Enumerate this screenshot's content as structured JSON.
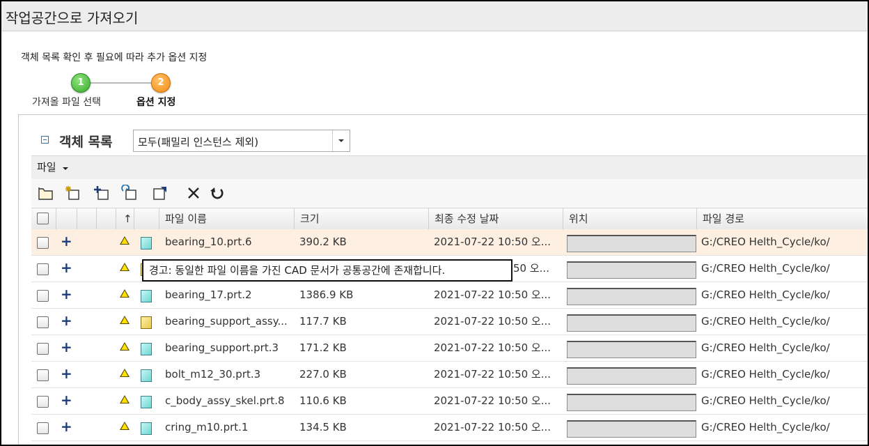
{
  "window": {
    "title": "작업공간으로 가져오기"
  },
  "instructions": "객체 목록 확인 후 필요에 따라 추가 옵션 지정",
  "steps": [
    {
      "number": "1",
      "label": "가져올 파일 선택",
      "status": "complete",
      "color": "#3fb030"
    },
    {
      "number": "2",
      "label": "옵션 지정",
      "status": "current",
      "color": "#f39a1e"
    }
  ],
  "object_list": {
    "title": "객체 목록",
    "filter_value": "모두(패밀리 인스턴스 제외)"
  },
  "menu": {
    "file_label": "파일"
  },
  "toolbar": {
    "icons": [
      "open-folder-icon",
      "new-item-icon",
      "add-item-icon",
      "refresh-item-icon",
      "export-item-icon",
      "delete-icon",
      "undo-icon"
    ]
  },
  "table": {
    "columns": {
      "sort": "↑",
      "name": "파일 이름",
      "size": "크기",
      "modified": "최종 수정 날짜",
      "location": "위치",
      "path": "파일 경로"
    },
    "rows": [
      {
        "name": "bearing_10.prt.6",
        "size": "390.2 KB",
        "modified": "2021-07-22 10:50 오...",
        "path": "G:/CREO Helth_Cycle/ko/",
        "type": "part",
        "selected": true
      },
      {
        "name": "",
        "size": "",
        "modified": "50 오...",
        "path": "G:/CREO Helth_Cycle/ko/",
        "type": "assembly",
        "selected": false
      },
      {
        "name": "bearing_17.prt.2",
        "size": "1386.9 KB",
        "modified": "2021-07-22 10:50 오...",
        "path": "G:/CREO Helth_Cycle/ko/",
        "type": "part",
        "selected": false
      },
      {
        "name": "bearing_support_assy...",
        "size": "117.7 KB",
        "modified": "2021-07-22 10:50 오...",
        "path": "G:/CREO Helth_Cycle/ko/",
        "type": "assembly",
        "selected": false
      },
      {
        "name": "bearing_support.prt.3",
        "size": "171.2 KB",
        "modified": "2021-07-22 10:50 오...",
        "path": "G:/CREO Helth_Cycle/ko/",
        "type": "part",
        "selected": false
      },
      {
        "name": "bolt_m12_30.prt.3",
        "size": "227.0 KB",
        "modified": "2021-07-22 10:50 오...",
        "path": "G:/CREO Helth_Cycle/ko/",
        "type": "part",
        "selected": false
      },
      {
        "name": "c_body_assy_skel.prt.8",
        "size": "110.6 KB",
        "modified": "2021-07-22 10:50 오...",
        "path": "G:/CREO Helth_Cycle/ko/",
        "type": "part",
        "selected": false
      },
      {
        "name": "cring_m10.prt.1",
        "size": "134.5 KB",
        "modified": "2021-07-22 10:50 오...",
        "path": "G:/CREO Helth_Cycle/ko/",
        "type": "part",
        "selected": false
      }
    ]
  },
  "tooltip": "경고: 동일한 파일 이름을 가진 CAD 문서가 공통공간에 존재합니다."
}
